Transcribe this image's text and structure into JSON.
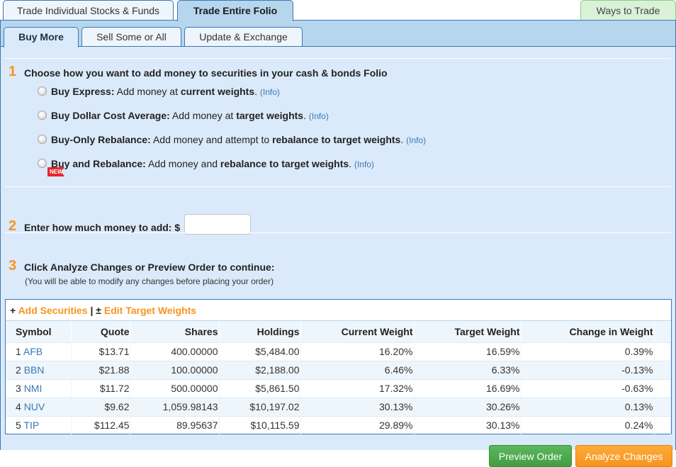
{
  "top_tabs": [
    {
      "label": "Trade Individual Stocks & Funds",
      "active": false
    },
    {
      "label": "Trade Entire Folio",
      "active": true
    }
  ],
  "ways_to_trade_label": "Ways to Trade",
  "sub_tabs": [
    {
      "label": "Buy More",
      "active": true
    },
    {
      "label": "Sell Some or All",
      "active": false
    },
    {
      "label": "Update & Exchange",
      "active": false
    }
  ],
  "step1": {
    "number": "1",
    "title": "Choose how you want to add money to securities in your cash & bonds Folio",
    "options": [
      {
        "name": "Buy Express:",
        "pre": " Add money at ",
        "bold": "current weights",
        "post": ".",
        "info": "(Info)",
        "selected": false,
        "new": false
      },
      {
        "name": "Buy Dollar Cost Average:",
        "pre": " Add money at ",
        "bold": "target weights",
        "post": ".",
        "info": "(Info)",
        "selected": false,
        "new": false
      },
      {
        "name": "Buy-Only Rebalance:",
        "pre": " Add money and attempt to ",
        "bold": "rebalance to target weights",
        "post": ".",
        "info": "(Info)",
        "selected": false,
        "new": false
      },
      {
        "name": "Buy and Rebalance:",
        "pre": " Add money and ",
        "bold": "rebalance to target weights",
        "post": ".",
        "info": "(Info)",
        "selected": false,
        "new": true
      }
    ],
    "new_badge": "NEW"
  },
  "step2": {
    "number": "2",
    "title": "Enter how much money to add: $",
    "amount_value": ""
  },
  "step3": {
    "number": "3",
    "title": "Click Analyze Changes or Preview Order to continue:",
    "note": "(You will be able to modify any changes before placing your order)"
  },
  "table_actions": {
    "add_prefix": "+",
    "add_label": "Add Securities",
    "separator": "|",
    "edit_prefix": "±",
    "edit_label": "Edit Target Weights"
  },
  "table": {
    "columns": [
      "Symbol",
      "Quote",
      "Shares",
      "Holdings",
      "Current Weight",
      "Target Weight",
      "Change in Weight"
    ],
    "rows": [
      {
        "index": "1",
        "symbol": "AFB",
        "quote": "$13.71",
        "shares": "400.00000",
        "holdings": "$5,484.00",
        "current": "16.20%",
        "target": "16.59%",
        "change": "0.39%"
      },
      {
        "index": "2",
        "symbol": "BBN",
        "quote": "$21.88",
        "shares": "100.00000",
        "holdings": "$2,188.00",
        "current": "6.46%",
        "target": "6.33%",
        "change": "-0.13%"
      },
      {
        "index": "3",
        "symbol": "NMI",
        "quote": "$11.72",
        "shares": "500.00000",
        "holdings": "$5,861.50",
        "current": "17.32%",
        "target": "16.69%",
        "change": "-0.63%"
      },
      {
        "index": "4",
        "symbol": "NUV",
        "quote": "$9.62",
        "shares": "1,059.98143",
        "holdings": "$10,197.02",
        "current": "30.13%",
        "target": "30.26%",
        "change": "0.13%"
      },
      {
        "index": "5",
        "symbol": "TIP",
        "quote": "$112.45",
        "shares": "89.95637",
        "holdings": "$10,115.59",
        "current": "29.89%",
        "target": "30.13%",
        "change": "0.24%"
      }
    ]
  },
  "buttons": {
    "preview": "Preview Order",
    "analyze": "Analyze Changes"
  },
  "colors": {
    "accent_orange": "#f7941d",
    "link_blue": "#3a78b5",
    "preview_green": "#5cb85c",
    "panel_blue": "#b6d6ee",
    "content_blue": "#dbeafa"
  }
}
